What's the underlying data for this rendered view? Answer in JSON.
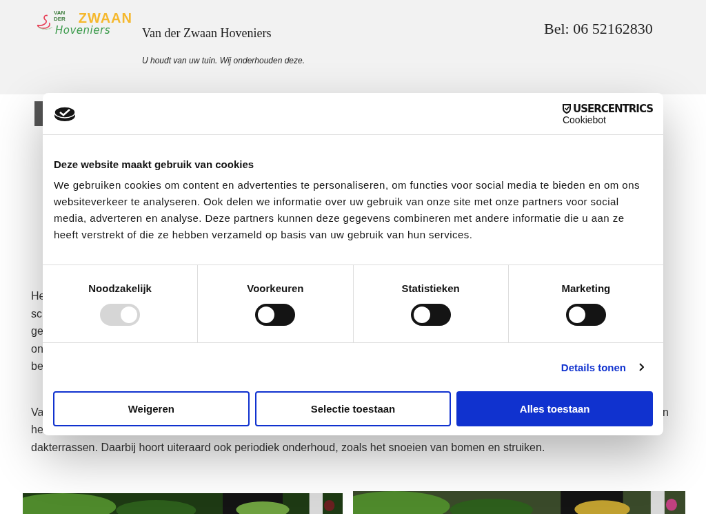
{
  "header": {
    "logo": {
      "top": "VAN DER",
      "main": "ZWAAN",
      "script": "Hoveniers"
    },
    "site_title": "Van der Zwaan Hoveniers",
    "tagline": "U houdt van uw tuin. Wij onderhouden deze.",
    "phone": "Bel: 06 52162830"
  },
  "page": {
    "paragraph_1_fragments": [
      "He",
      "sc",
      "ge",
      "on",
      "be"
    ],
    "paragraph_2": {
      "left_fragments": [
        "Va",
        "he"
      ],
      "right_fragment": "n",
      "last_line": "dakterrassen. Daarbij hoort uiteraard ook periodiek onderhoud, zoals het snoeien van bomen en struiken."
    }
  },
  "cookie_dialog": {
    "brand": {
      "name": "USERCENTRICS",
      "product": "Cookiebot"
    },
    "title": "Deze website maakt gebruik van cookies",
    "text": "We gebruiken cookies om content en advertenties te personaliseren, om functies voor social media te bieden en om ons websiteverkeer te analyseren. Ook delen we informatie over uw gebruik van onze site met onze partners voor social media, adverteren en analyse. Deze partners kunnen deze gegevens combineren met andere informatie die u aan ze heeft verstrekt of die ze hebben verzameld op basis van uw gebruik van hun services.",
    "categories": [
      {
        "label": "Noodzakelijk",
        "on": true,
        "disabled": true
      },
      {
        "label": "Voorkeuren",
        "on": false,
        "disabled": false
      },
      {
        "label": "Statistieken",
        "on": false,
        "disabled": false
      },
      {
        "label": "Marketing",
        "on": false,
        "disabled": false
      }
    ],
    "details_link": "Details tonen",
    "buttons": [
      {
        "label": "Weigeren",
        "kind": "outline"
      },
      {
        "label": "Selectie toestaan",
        "kind": "outline"
      },
      {
        "label": "Alles toestaan",
        "kind": "primary"
      }
    ]
  }
}
